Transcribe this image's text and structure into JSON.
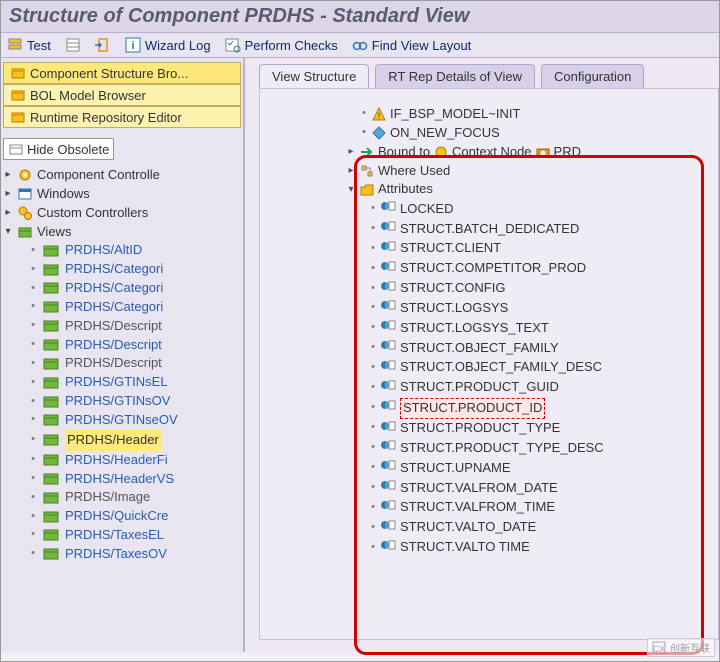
{
  "title": "Structure of Component PRDHS - Standard View",
  "toolbar": {
    "test": "Test",
    "wizard_log": "Wizard Log",
    "perform_checks": "Perform Checks",
    "find_view_layout": "Find View Layout"
  },
  "left": {
    "browsers": [
      {
        "label": "Component Structure Bro...",
        "active": true
      },
      {
        "label": "BOL Model Browser",
        "active": false
      },
      {
        "label": "Runtime Repository Editor",
        "active": false
      }
    ],
    "hide_obsolete": "Hide Obsolete",
    "tree": {
      "component_controller": "Component Controlle",
      "windows": "Windows",
      "custom_controllers": "Custom Controllers",
      "views_label": "Views",
      "views": [
        {
          "text": "PRDHS/AltID",
          "style": "blue"
        },
        {
          "text": "PRDHS/Categori",
          "style": "blue"
        },
        {
          "text": "PRDHS/Categori",
          "style": "blue"
        },
        {
          "text": "PRDHS/Categori",
          "style": "blue"
        },
        {
          "text": "PRDHS/Descript",
          "style": "grey"
        },
        {
          "text": "PRDHS/Descript",
          "style": "blue"
        },
        {
          "text": "PRDHS/Descript",
          "style": "grey"
        },
        {
          "text": "PRDHS/GTINsEL",
          "style": "blue"
        },
        {
          "text": "PRDHS/GTINsOV",
          "style": "blue"
        },
        {
          "text": "PRDHS/GTINseOV",
          "style": "blue"
        },
        {
          "text": "PRDHS/Header",
          "style": "selected"
        },
        {
          "text": "PRDHS/HeaderFi",
          "style": "blue"
        },
        {
          "text": "PRDHS/HeaderVS",
          "style": "blue"
        },
        {
          "text": "PRDHS/Image",
          "style": "grey"
        },
        {
          "text": "PRDHS/QuickCre",
          "style": "blue"
        },
        {
          "text": "PRDHS/TaxesEL",
          "style": "blue"
        },
        {
          "text": "PRDHS/TaxesOV",
          "style": "blue"
        }
      ]
    }
  },
  "right": {
    "tabs": [
      {
        "label": "View Structure",
        "active": true
      },
      {
        "label": "RT Rep Details of View",
        "active": false
      },
      {
        "label": "Configuration",
        "active": false
      }
    ],
    "rows": {
      "init": "IF_BSP_MODEL~INIT",
      "focus": "ON_NEW_FOCUS",
      "bound_to": "Bound to",
      "context_node": "Context Node",
      "prd": "PRD",
      "where_used": "Where Used",
      "attributes": "Attributes"
    },
    "attributes": [
      {
        "text": "LOCKED",
        "hl": false
      },
      {
        "text": "STRUCT.BATCH_DEDICATED",
        "hl": false
      },
      {
        "text": "STRUCT.CLIENT",
        "hl": false
      },
      {
        "text": "STRUCT.COMPETITOR_PROD",
        "hl": false
      },
      {
        "text": "STRUCT.CONFIG",
        "hl": false
      },
      {
        "text": "STRUCT.LOGSYS",
        "hl": false
      },
      {
        "text": "STRUCT.LOGSYS_TEXT",
        "hl": false
      },
      {
        "text": "STRUCT.OBJECT_FAMILY",
        "hl": false
      },
      {
        "text": "STRUCT.OBJECT_FAMILY_DESC",
        "hl": false
      },
      {
        "text": "STRUCT.PRODUCT_GUID",
        "hl": false
      },
      {
        "text": "STRUCT.PRODUCT_ID",
        "hl": true
      },
      {
        "text": "STRUCT.PRODUCT_TYPE",
        "hl": false
      },
      {
        "text": "STRUCT.PRODUCT_TYPE_DESC",
        "hl": false
      },
      {
        "text": "STRUCT.UPNAME",
        "hl": false
      },
      {
        "text": "STRUCT.VALFROM_DATE",
        "hl": false
      },
      {
        "text": "STRUCT.VALFROM_TIME",
        "hl": false
      },
      {
        "text": "STRUCT.VALTO_DATE",
        "hl": false
      },
      {
        "text": "STRUCT.VALTO TIME",
        "hl": false
      }
    ]
  },
  "watermark": "创新互联"
}
